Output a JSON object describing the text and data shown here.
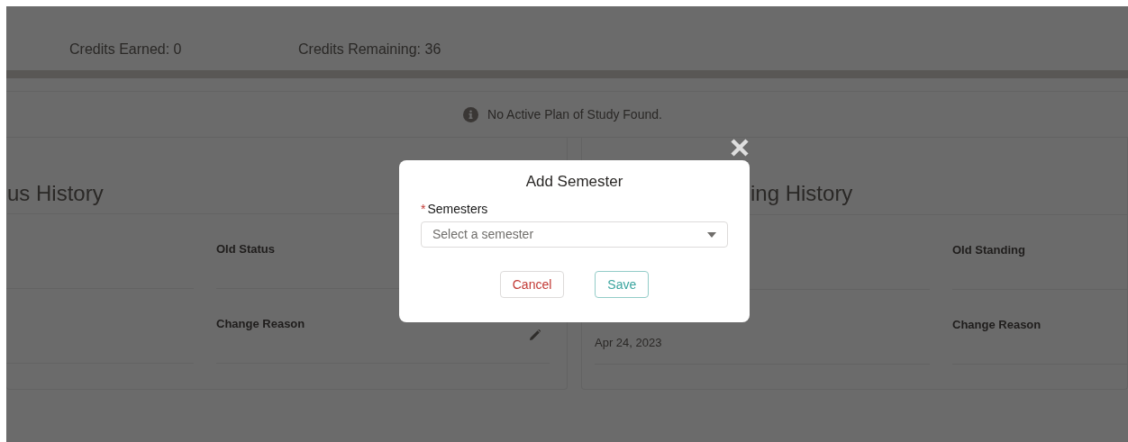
{
  "summary": {
    "credits_earned": "Credits Earned: 0",
    "credits_remaining": "Credits Remaining: 36"
  },
  "notice": {
    "text": "No Active Plan of Study Found."
  },
  "cards": [
    {
      "title": "us History",
      "fields": [
        {
          "kind": "blank"
        },
        {
          "kind": "field",
          "label": "Old Status",
          "editable": false
        },
        {
          "kind": "blank"
        },
        {
          "kind": "field",
          "label": "Change Reason",
          "editable": true
        }
      ]
    },
    {
      "title": "ing History",
      "fields": [
        {
          "kind": "blank"
        },
        {
          "kind": "field",
          "label": "Old Standing",
          "editable": false
        },
        {
          "kind": "value",
          "value": "Apr 24, 2023",
          "editable": false
        },
        {
          "kind": "field",
          "label": "Change Reason",
          "editable": false
        }
      ]
    }
  ],
  "modal": {
    "title": "Add Semester",
    "field": {
      "required_mark": "*",
      "label": "Semesters",
      "placeholder": "Select a semester"
    },
    "buttons": [
      {
        "label": "Cancel",
        "kind": "cancel"
      },
      {
        "label": "Save",
        "kind": "save"
      }
    ]
  }
}
